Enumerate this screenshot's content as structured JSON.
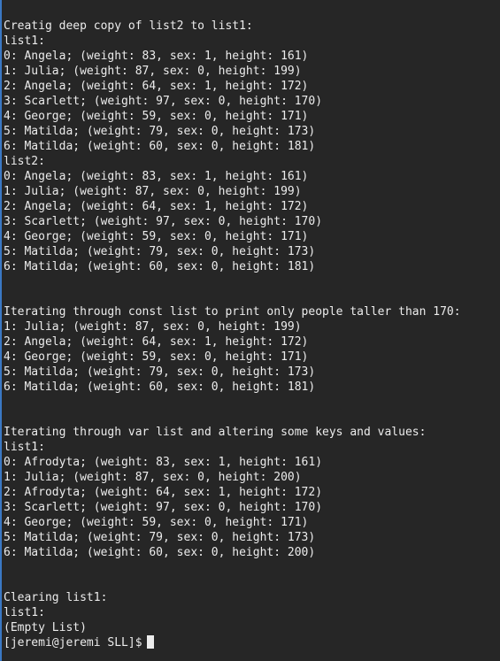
{
  "terminal": {
    "lines": [
      "Creatig deep copy of list2 to list1:",
      "list1:",
      "0: Angela; (weight: 83, sex: 1, height: 161)",
      "1: Julia; (weight: 87, sex: 0, height: 199)",
      "2: Angela; (weight: 64, sex: 1, height: 172)",
      "3: Scarlett; (weight: 97, sex: 0, height: 170)",
      "4: George; (weight: 59, sex: 0, height: 171)",
      "5: Matilda; (weight: 79, sex: 0, height: 173)",
      "6: Matilda; (weight: 60, sex: 0, height: 181)",
      "list2:",
      "0: Angela; (weight: 83, sex: 1, height: 161)",
      "1: Julia; (weight: 87, sex: 0, height: 199)",
      "2: Angela; (weight: 64, sex: 1, height: 172)",
      "3: Scarlett; (weight: 97, sex: 0, height: 170)",
      "4: George; (weight: 59, sex: 0, height: 171)",
      "5: Matilda; (weight: 79, sex: 0, height: 173)",
      "6: Matilda; (weight: 60, sex: 0, height: 181)",
      "",
      "",
      "Iterating through const list to print only people taller than 170:",
      "1: Julia; (weight: 87, sex: 0, height: 199)",
      "2: Angela; (weight: 64, sex: 1, height: 172)",
      "4: George; (weight: 59, sex: 0, height: 171)",
      "5: Matilda; (weight: 79, sex: 0, height: 173)",
      "6: Matilda; (weight: 60, sex: 0, height: 181)",
      "",
      "",
      "Iterating through var list and altering some keys and values:",
      "list1:",
      "0: Afrodyta; (weight: 83, sex: 1, height: 161)",
      "1: Julia; (weight: 87, sex: 0, height: 200)",
      "2: Afrodyta; (weight: 64, sex: 1, height: 172)",
      "3: Scarlett; (weight: 97, sex: 0, height: 170)",
      "4: George; (weight: 59, sex: 0, height: 171)",
      "5: Matilda; (weight: 79, sex: 0, height: 173)",
      "6: Matilda; (weight: 60, sex: 0, height: 200)",
      "",
      "",
      "Clearing list1:",
      "list1:",
      "(Empty List)"
    ],
    "prompt": "[jeremi@jeremi SLL]$"
  },
  "colors": {
    "background": "#262626",
    "text": "#ececec",
    "left_edge": "#3a78c4"
  }
}
